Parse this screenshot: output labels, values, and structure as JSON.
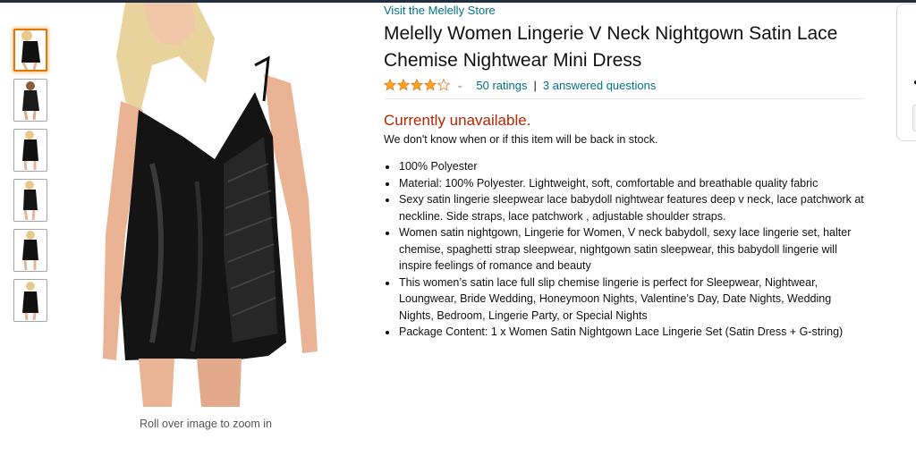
{
  "store": {
    "link_text": "Visit the Melelly Store"
  },
  "product": {
    "title": "Melelly Women Lingerie V Neck Nightgown Satin Lace Chemise Nightwear Mini Dress",
    "rating": 4.0,
    "rating_max": 5,
    "ratings_count_text": "50 ratings",
    "separator": "|",
    "answered_questions_text": "3 answered questions"
  },
  "availability": {
    "status": "Currently unavailable.",
    "note": "We don't know when or if this item will be back in stock."
  },
  "bullets": [
    "100% Polyester",
    "Material: 100% Polyester. Lightweight, soft, comfortable and breathable quality fabric",
    "Sexy satin lingerie sleepwear lace babydoll nightwear features deep v neck, lace patchwork at neckline. Side straps, lace patchwork , adjustable shoulder straps.",
    "Women satin nightgown, Lingerie for Women, V neck babydoll, sexy lace lingerie set, halter chemise, spaghetti strap sleepwear, nightgown satin sleepwear, this babydoll lingerie will inspire feelings of romance and beauty",
    "This women’s satin lace full slip chemise lingerie is perfect for Sleepwear, Nightwear, Loungwear, Bride Wedding, Honeymoon Nights, Valentine’s Day, Date Nights, Wedding Nights, Bedroom, Lingerie Party, or Special Nights",
    "Package Content: 1 x Women Satin Nightgown Lace Lingerie Set (Satin Dress + G-string)"
  ],
  "gallery": {
    "zoom_hint": "Roll over image to zoom in",
    "thumbnail_count": 6,
    "selected_index": 0
  },
  "colors": {
    "link": "#007185",
    "unavailable": "#b12704",
    "star": "#ffa41c",
    "thumb_selected_border": "#e77600"
  }
}
